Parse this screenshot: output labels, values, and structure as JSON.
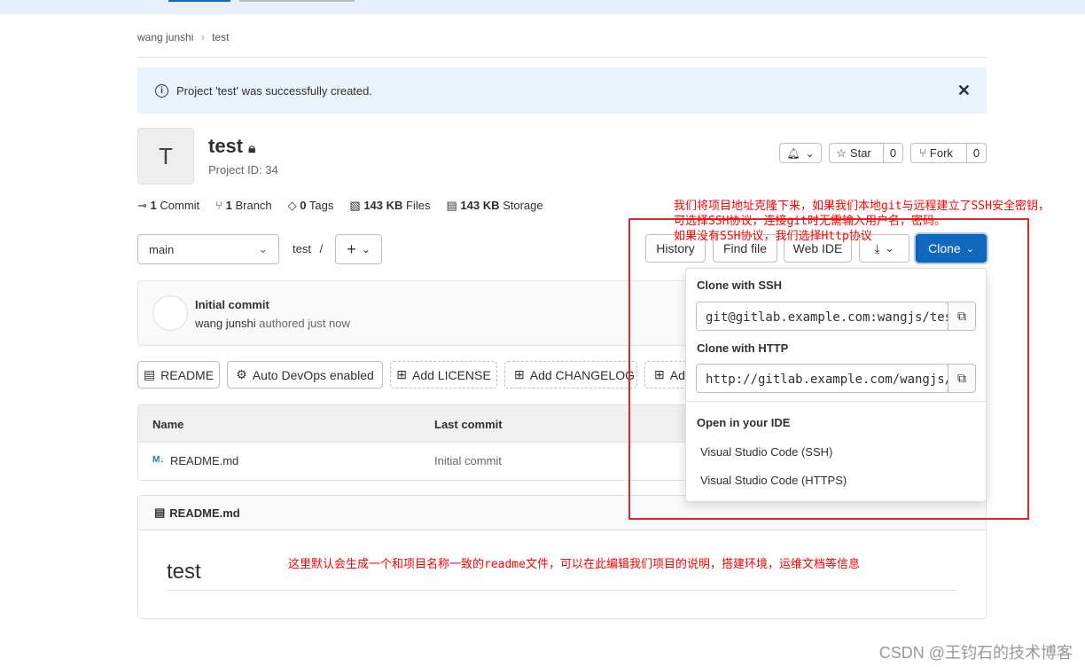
{
  "breadcrumb": {
    "owner": "wang junshi",
    "project": "test"
  },
  "alert": {
    "text": "Project 'test' was successfully created."
  },
  "project": {
    "avatar_letter": "T",
    "name": "test",
    "id_text": "Project ID: 34"
  },
  "actions": {
    "star_label": "Star",
    "star_count": "0",
    "fork_label": "Fork",
    "fork_count": "0"
  },
  "stats": [
    {
      "num": "1",
      "label": "Commit"
    },
    {
      "num": "1",
      "label": "Branch"
    },
    {
      "num": "0",
      "label": "Tags"
    },
    {
      "num": "143 KB",
      "label": "Files"
    },
    {
      "num": "143 KB",
      "label": "Storage"
    }
  ],
  "toolbar": {
    "branch": "main",
    "path": "test",
    "sep": "/",
    "plus": "+",
    "history": "History",
    "find_file": "Find file",
    "web_ide": "Web IDE",
    "clone": "Clone"
  },
  "commit": {
    "title": "Initial commit",
    "author": "wang junshi",
    "meta": "authored just now"
  },
  "quick": [
    "README",
    "Auto DevOps enabled",
    "Add LICENSE",
    "Add CHANGELOG",
    "Ad"
  ],
  "table": {
    "headers": [
      "Name",
      "Last commit"
    ],
    "rows": [
      {
        "name": "README.md",
        "commit": "Initial commit"
      }
    ]
  },
  "readme": {
    "file": "README.md",
    "heading": "test"
  },
  "clone_menu": {
    "ssh_title": "Clone with SSH",
    "ssh_url": "git@gitlab.example.com:wangjs/test.git",
    "http_title": "Clone with HTTP",
    "http_url": "http://gitlab.example.com/wangjs/test.git",
    "ide_title": "Open in your IDE",
    "ide_items": [
      "Visual Studio Code (SSH)",
      "Visual Studio Code (HTTPS)"
    ]
  },
  "annotations": {
    "clone_note": [
      "我们将项目地址克隆下来，如果我们本地git与远程建立了SSH安全密钥，",
      "可选择SSH协议，连接git时无需输入用户名，密码。",
      "如果没有SSH协议，我们选择Http协议"
    ],
    "readme_note": "这里默认会生成一个和项目名称一致的readme文件，可以在此编辑我们项目的说明，搭建环境，运维文档等信息"
  },
  "watermark": "CSDN @王钧石的技术博客",
  "colors": {
    "primary": "#1068bf",
    "alert_bg": "#e9f3fc",
    "annotation": "#ff0000"
  }
}
